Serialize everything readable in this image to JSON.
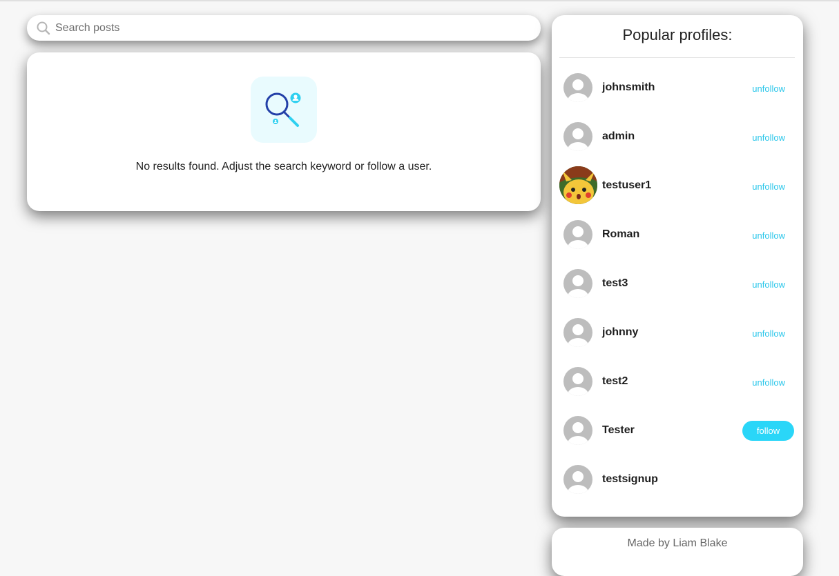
{
  "search": {
    "placeholder": "Search posts",
    "icon": "search-icon"
  },
  "results": {
    "empty_message": "No results found. Adjust the search keyword or follow a user.",
    "illustration": "search-users-icon"
  },
  "sidebar": {
    "title": "Popular profiles:",
    "profiles": [
      {
        "username": "johnsmith",
        "action": "unfollow"
      },
      {
        "username": "admin",
        "action": "unfollow"
      },
      {
        "username": "testuser1",
        "action": "unfollow",
        "avatar": "pikachu-avatar"
      },
      {
        "username": "Roman",
        "action": "unfollow"
      },
      {
        "username": "test3",
        "action": "unfollow"
      },
      {
        "username": "johnny",
        "action": "unfollow"
      },
      {
        "username": "test2",
        "action": "unfollow"
      },
      {
        "username": "Tester",
        "action": "follow"
      },
      {
        "username": "testsignup",
        "action": ""
      }
    ]
  },
  "footer": {
    "text": "Made by Liam Blake"
  },
  "colors": {
    "accent": "#2ad6f8",
    "link": "#29c6ea",
    "background": "#f7f7f7",
    "avatar_placeholder": "#bdbdbd"
  }
}
